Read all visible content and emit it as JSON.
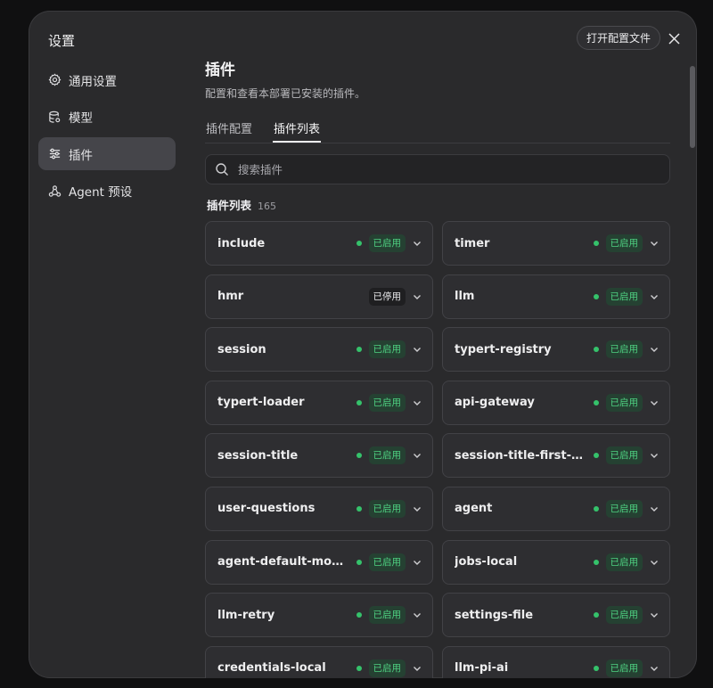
{
  "dialog": {
    "title": "设置",
    "open_config_label": "打开配置文件"
  },
  "sidebar": {
    "items": [
      {
        "label": "通用设置",
        "icon": "gear-icon"
      },
      {
        "label": "模型",
        "icon": "database-icon"
      },
      {
        "label": "插件",
        "icon": "sliders-icon",
        "active": true
      },
      {
        "label": "Agent 预设",
        "icon": "agent-icon"
      }
    ]
  },
  "main": {
    "title": "插件",
    "description": "配置和查看本部署已安装的插件。",
    "tabs": [
      {
        "label": "插件配置"
      },
      {
        "label": "插件列表",
        "active": true
      }
    ],
    "search": {
      "placeholder": "搜索插件",
      "value": ""
    },
    "list": {
      "title": "插件列表",
      "count": "165"
    }
  },
  "plugins": [
    {
      "name": "include",
      "status": "已启用",
      "enabled": true
    },
    {
      "name": "timer",
      "status": "已启用",
      "enabled": true
    },
    {
      "name": "hmr",
      "status": "已停用",
      "enabled": false
    },
    {
      "name": "llm",
      "status": "已启用",
      "enabled": true
    },
    {
      "name": "session",
      "status": "已启用",
      "enabled": true
    },
    {
      "name": "typert-registry",
      "status": "已启用",
      "enabled": true
    },
    {
      "name": "typert-loader",
      "status": "已启用",
      "enabled": true
    },
    {
      "name": "api-gateway",
      "status": "已启用",
      "enabled": true
    },
    {
      "name": "session-title",
      "status": "已启用",
      "enabled": true
    },
    {
      "name": "session-title-first-pro...",
      "status": "已启用",
      "enabled": true
    },
    {
      "name": "user-questions",
      "status": "已启用",
      "enabled": true
    },
    {
      "name": "agent",
      "status": "已启用",
      "enabled": true
    },
    {
      "name": "agent-default-model",
      "status": "已启用",
      "enabled": true
    },
    {
      "name": "jobs-local",
      "status": "已启用",
      "enabled": true
    },
    {
      "name": "llm-retry",
      "status": "已启用",
      "enabled": true
    },
    {
      "name": "settings-file",
      "status": "已启用",
      "enabled": true
    },
    {
      "name": "credentials-local",
      "status": "已启用",
      "enabled": true
    },
    {
      "name": "llm-pi-ai",
      "status": "已启用",
      "enabled": true
    }
  ],
  "colors": {
    "enabled_text": "#4ed181",
    "enabled_bg": "#254132",
    "dot": "#35c26b",
    "panel": "#2a2a2c"
  }
}
